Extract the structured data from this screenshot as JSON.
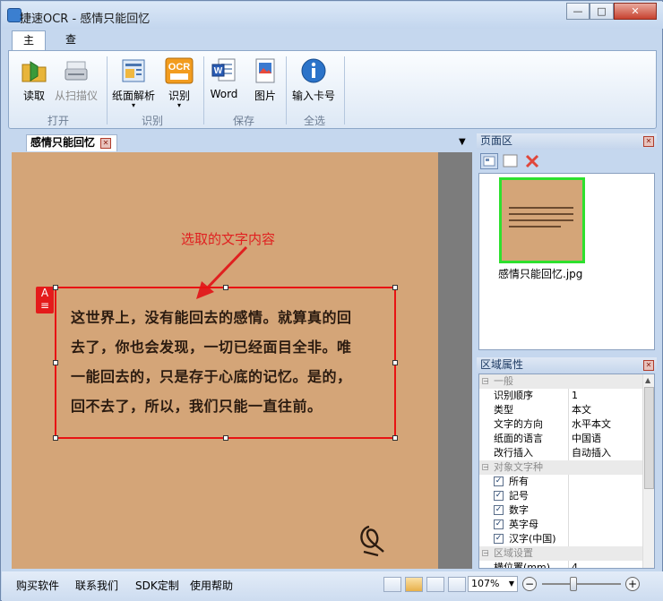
{
  "window": {
    "title": "捷速OCR - 感情只能回忆",
    "minimize": "—",
    "maximize": "□",
    "close": "✕"
  },
  "ribbon": {
    "tabs": [
      {
        "label": "主页",
        "active": true
      },
      {
        "label": "查看",
        "active": false
      }
    ],
    "buttons": {
      "read": "读取",
      "scanner": "从扫描仪",
      "layout": "纸面解析",
      "recognize": "识别",
      "word": "Word",
      "image": "图片",
      "input_card": "输入卡号"
    },
    "groups": {
      "open": "打开",
      "recognize": "识别",
      "save": "保存",
      "select_all": "全选"
    },
    "ocr_icon_text": "OCR"
  },
  "document": {
    "tab_label": "感情只能回忆",
    "annotation": "选取的文字内容",
    "region_marker": "A",
    "text_lines": [
      "这世界上，没有能回去的感情。就算真的回",
      "去了，你也会发现，一切已经面目全非。唯",
      "一能回去的，只是存于心底的记忆。是的，",
      "回不去了，所以，我们只能一直往前。"
    ]
  },
  "pages_panel": {
    "title": "页面区",
    "thumbnail_label": "感情只能回忆.jpg"
  },
  "properties_panel": {
    "title": "区域属性",
    "general": {
      "header": "一般",
      "rows": [
        {
          "key": "识别顺序",
          "value": "1"
        },
        {
          "key": "类型",
          "value": "本文"
        },
        {
          "key": "文字的方向",
          "value": "水平本文"
        },
        {
          "key": "纸面的语言",
          "value": "中国语"
        },
        {
          "key": "改行插入",
          "value": "自动插入"
        }
      ]
    },
    "target_chars": {
      "header": "对象文字种",
      "items": [
        {
          "label": "所有",
          "checked": true
        },
        {
          "label": "記号",
          "checked": true
        },
        {
          "label": "数字",
          "checked": true
        },
        {
          "label": "英字母",
          "checked": true
        },
        {
          "label": "汉字(中国)",
          "checked": true
        }
      ]
    },
    "region_settings": {
      "header": "区域设置",
      "rows": [
        {
          "key": "横位置(mm)",
          "value": "4"
        }
      ]
    }
  },
  "statusbar": {
    "links": [
      "购买软件",
      "联系我们",
      "SDK定制",
      "使用帮助"
    ],
    "zoom": "107%",
    "zoom_out": "−",
    "zoom_in": "+",
    "zoom_level_fraction": 0.45
  },
  "colors": {
    "selection": "#e81313",
    "annotation": "#e02020",
    "thumbnail_border": "#2ee02e",
    "paper": "#d4a578"
  }
}
